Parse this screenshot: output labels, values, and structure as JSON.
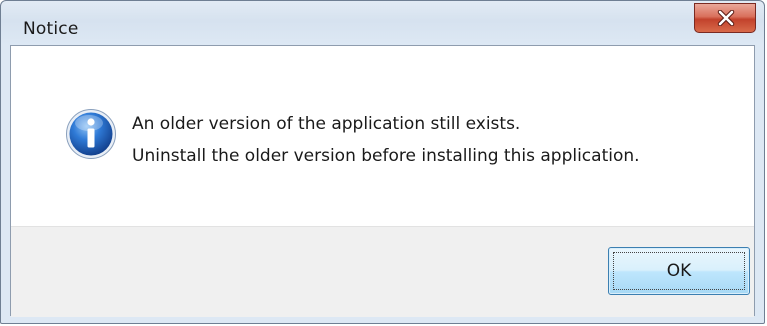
{
  "window": {
    "title": "Notice",
    "close_icon": "close-x-icon"
  },
  "dialog": {
    "icon": "info-icon",
    "message_lines": [
      "An older version of the application still exists.",
      "Uninstall the older version before installing this application."
    ]
  },
  "buttons": {
    "ok_label": "OK"
  },
  "colors": {
    "titlebar": "#d6e2ef",
    "close_button": "#c2422c",
    "info_icon": "#1f5fb6",
    "footer_background": "#f0f0f0",
    "ok_button": "#bee6fd"
  }
}
